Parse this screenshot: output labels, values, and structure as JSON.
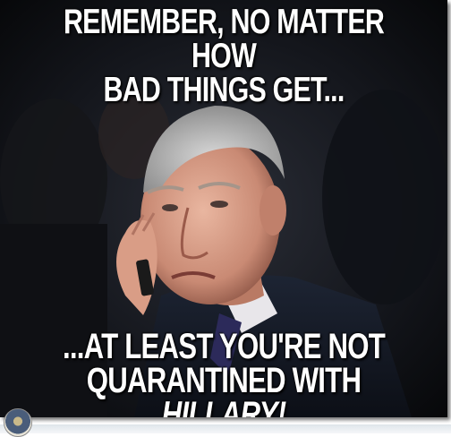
{
  "meme": {
    "top_text_line1": "REMEMBER, NO MATTER HOW",
    "top_text_line2": "BAD THINGS GET...",
    "bottom_text_line1": "...AT LEAST YOU'RE NOT",
    "bottom_text_line2_plain": "QUARANTINED WITH ",
    "bottom_text_line2_emphasis": "HILLARY!",
    "photo_description_icon": "photo-of-man-touching-face"
  },
  "colors": {
    "background": "#0b0b0d",
    "caption_text": "#ffffff"
  }
}
